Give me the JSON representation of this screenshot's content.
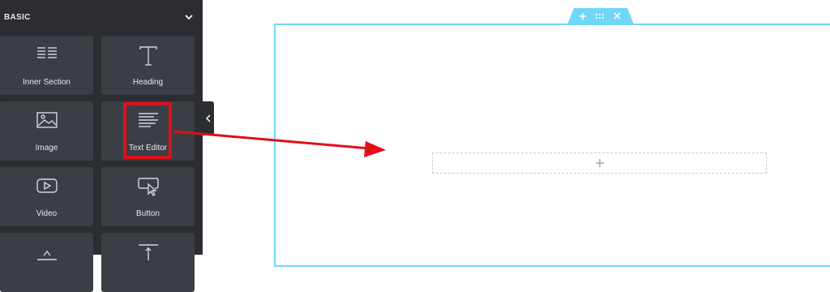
{
  "panel": {
    "category_title": "BASIC",
    "widgets": [
      {
        "label": "Inner Section",
        "icon": "inner-section-icon"
      },
      {
        "label": "Heading",
        "icon": "heading-icon"
      },
      {
        "label": "Image",
        "icon": "image-icon"
      },
      {
        "label": "Text Editor",
        "icon": "text-editor-icon"
      },
      {
        "label": "Video",
        "icon": "video-icon"
      },
      {
        "label": "Button",
        "icon": "button-icon"
      },
      {
        "label": "",
        "icon": "divider-icon"
      },
      {
        "label": "",
        "icon": "spacer-icon"
      }
    ]
  },
  "canvas": {
    "section_handle_icons": [
      "plus-icon",
      "drag-icon",
      "close-icon"
    ],
    "drop_zone_icon": "plus-icon"
  },
  "colors": {
    "panel_bg": "#2b2d31",
    "tile_bg": "#3b3e44",
    "section_border": "#71d7f7",
    "annotation_red": "#e0101a"
  }
}
